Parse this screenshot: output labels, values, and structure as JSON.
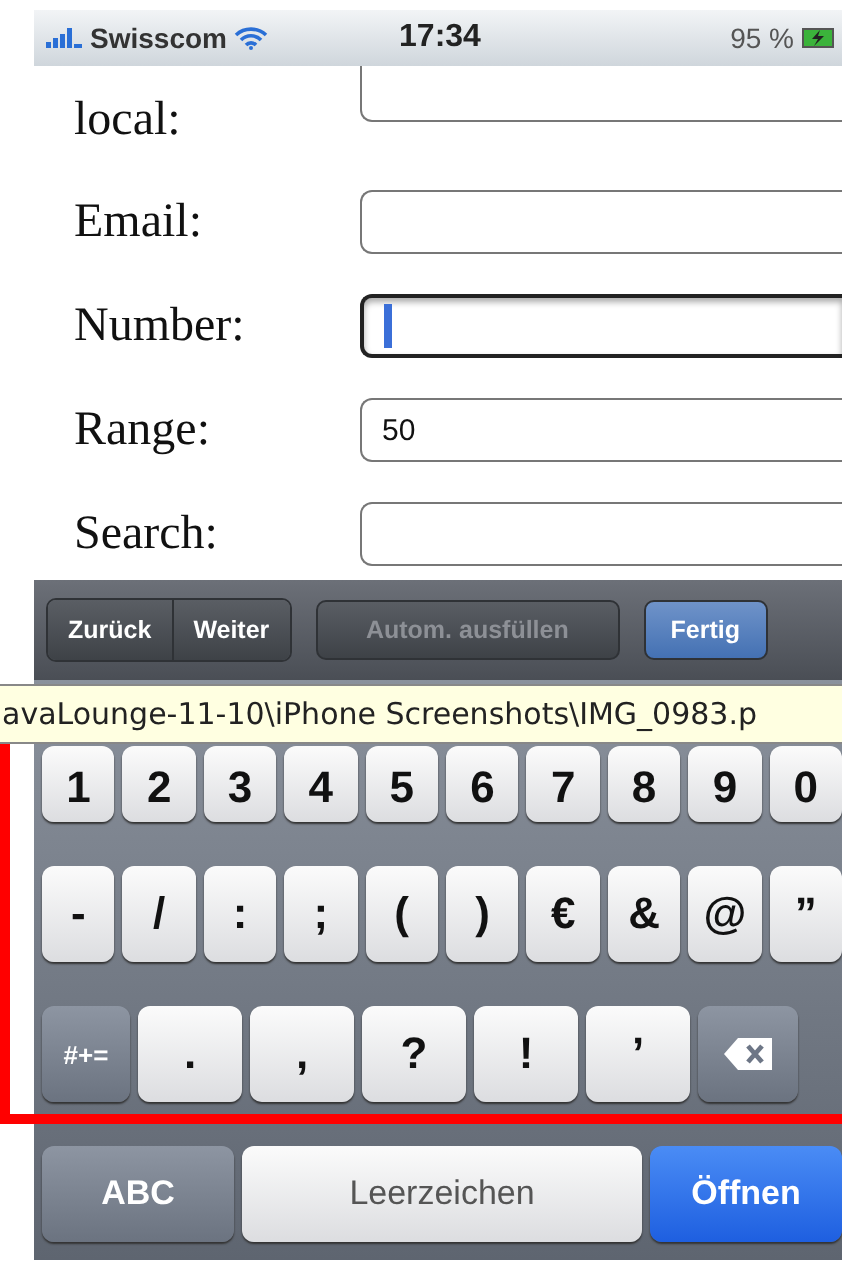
{
  "status_bar": {
    "carrier": "Swisscom",
    "time": "17:34",
    "battery": "95 %"
  },
  "form": {
    "fields": [
      {
        "label": "local:",
        "focused": false
      },
      {
        "label": "Email:",
        "focused": false
      },
      {
        "label": "Number:",
        "focused": true
      },
      {
        "label": "Range:",
        "value": "50",
        "focused": false
      },
      {
        "label": "Search:",
        "focused": false
      }
    ]
  },
  "toolbar": {
    "nav": [
      "Zurück",
      "Weiter"
    ],
    "autofill": {
      "label": "Autom. ausfüllen",
      "disabled": true
    },
    "done": "Fertig"
  },
  "tooltip": "avaLounge-11-10\\iPhone Screenshots\\IMG_0983.p",
  "keyboard": {
    "rows": [
      [
        "1",
        "2",
        "3",
        "4",
        "5",
        "6",
        "7",
        "8",
        "9",
        "0"
      ],
      [
        "-",
        "/",
        ":",
        ";",
        "(",
        ")",
        "€",
        "&",
        "@",
        "”"
      ]
    ],
    "shift_key": "#+=",
    "punctuation": [
      ".",
      ",",
      "?",
      "!",
      "’"
    ],
    "mode_key": "ABC",
    "space": "Leerzeichen",
    "return": "Öffnen"
  }
}
